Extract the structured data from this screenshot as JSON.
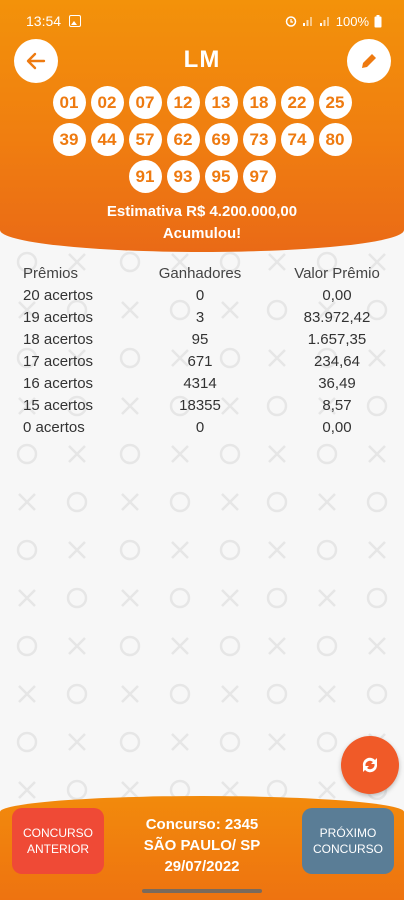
{
  "status_bar": {
    "time": "13:54",
    "battery": "100%"
  },
  "header": {
    "title": "LM",
    "numbers": [
      "01",
      "02",
      "07",
      "12",
      "13",
      "18",
      "22",
      "25",
      "39",
      "44",
      "57",
      "62",
      "69",
      "73",
      "74",
      "80",
      "91",
      "93",
      "95",
      "97"
    ],
    "estimate": "Estimativa R$ 4.200.000,00",
    "status": "Acumulou!"
  },
  "table": {
    "headers": [
      "Prêmios",
      "Ganhadores",
      "Valor Prêmio"
    ],
    "rows": [
      [
        "20 acertos",
        "0",
        "0,00"
      ],
      [
        "19 acertos",
        "3",
        "83.972,42"
      ],
      [
        "18 acertos",
        "95",
        "1.657,35"
      ],
      [
        "17 acertos",
        "671",
        "234,64"
      ],
      [
        "16 acertos",
        "4314",
        "36,49"
      ],
      [
        "15 acertos",
        "18355",
        "8,57"
      ],
      [
        "0 acertos",
        "0",
        "0,00"
      ]
    ]
  },
  "footer": {
    "prev_label": "CONCURSO ANTERIOR",
    "next_label": "PRÓXIMO CONCURSO",
    "contest": "Concurso: 2345",
    "location": "SÃO PAULO/ SP",
    "date": "29/07/2022"
  },
  "icons": {
    "back": "arrow-left-icon",
    "edit": "pencil-icon",
    "refresh": "refresh-icon"
  },
  "colors": {
    "accent": "#f07e10",
    "ball_text": "#ee7a10",
    "prev_button": "#ef4a36",
    "next_button": "#5a7d96",
    "fab": "#f05a28"
  }
}
